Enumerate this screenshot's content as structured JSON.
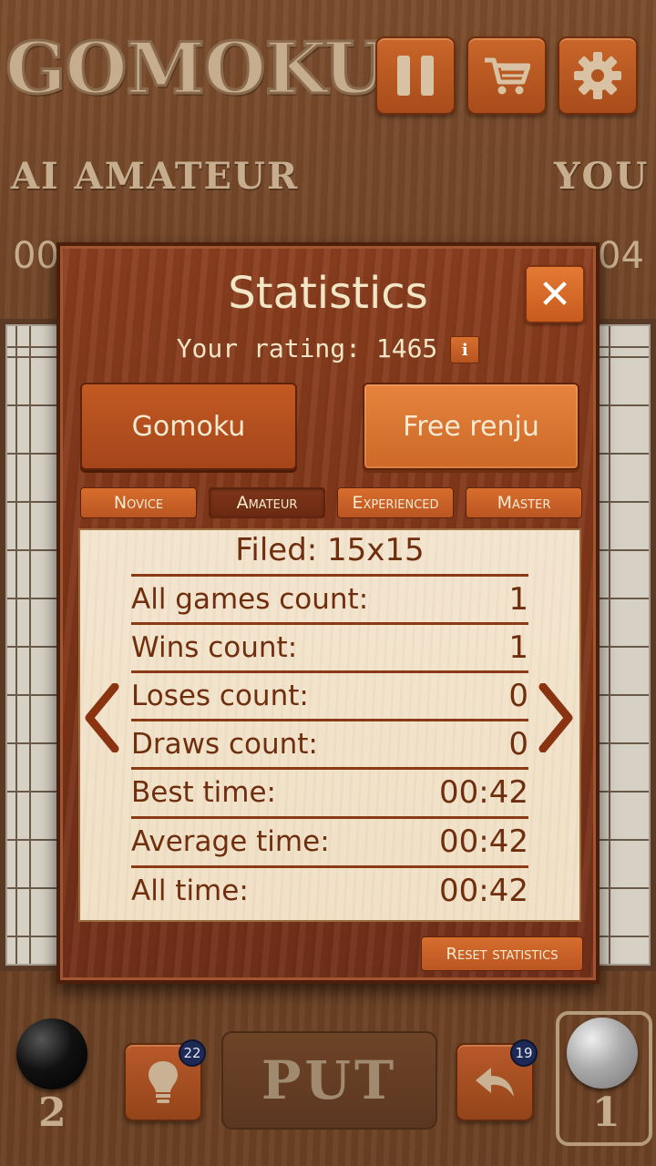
{
  "header": {
    "logo": "GOMOKU",
    "opponent": "AI AMATEUR",
    "player": "YOU",
    "opponent_timer": "00",
    "player_timer": "04"
  },
  "toolbar": {
    "pause_icon": "pause-icon",
    "shop_icon": "cart-icon",
    "settings_icon": "gear-icon"
  },
  "modal": {
    "title": "Statistics",
    "rating_label": "Your rating: 1465",
    "info_label": "i",
    "close_label": "✕",
    "modes": [
      "Gomoku",
      "Free renju"
    ],
    "active_mode": "Free renju",
    "levels": [
      "Novice",
      "Amateur",
      "Experienced",
      "Master"
    ],
    "selected_level": "Amateur",
    "field": "Filed: 15x15",
    "stats": [
      {
        "label": "All games count:",
        "value": "1"
      },
      {
        "label": "Wins count:",
        "value": "1"
      },
      {
        "label": "Loses count:",
        "value": "0"
      },
      {
        "label": "Draws count:",
        "value": "0"
      },
      {
        "label": "Best time:",
        "value": "00:42"
      },
      {
        "label": "Average time:",
        "value": "00:42"
      },
      {
        "label": "All time:",
        "value": "00:42"
      }
    ],
    "prev_label": "‹",
    "next_label": "›",
    "reset_label": "Reset statistics"
  },
  "bottom": {
    "black_count": "2",
    "white_count": "1",
    "hint_badge": "22",
    "undo_badge": "19",
    "put_label": "PUT"
  },
  "colors": {
    "wood": "#6f4325",
    "modal": "#7d3418",
    "button": "#c35a23",
    "panel": "#f2e4cd",
    "text_dark": "#6f2e0e"
  }
}
